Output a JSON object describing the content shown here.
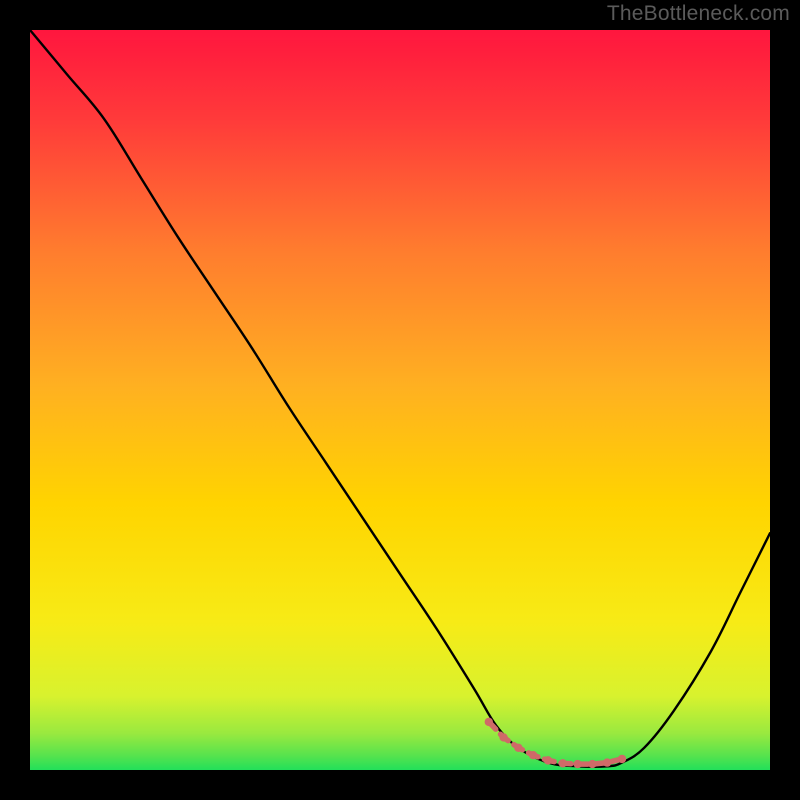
{
  "watermark": "TheBottleneck.com",
  "chart_data": {
    "type": "line",
    "title": "",
    "xlabel": "",
    "ylabel": "",
    "xlim": [
      0,
      100
    ],
    "ylim": [
      0,
      100
    ],
    "grid": false,
    "background_gradient": {
      "top_color": "#ff153e",
      "mid_color": "#ffd400",
      "bottom_color": "#20e35a"
    },
    "series": [
      {
        "name": "bottleneck-curve",
        "color": "#000000",
        "x": [
          0,
          5,
          10,
          15,
          20,
          25,
          30,
          35,
          40,
          45,
          50,
          55,
          60,
          63,
          66,
          70,
          74,
          78,
          80,
          83,
          87,
          92,
          96,
          100
        ],
        "values": [
          100,
          94,
          88,
          80,
          72,
          64.5,
          57,
          49,
          41.5,
          34,
          26.5,
          19,
          11,
          6,
          3,
          1,
          0.5,
          0.5,
          1,
          3,
          8,
          16,
          24,
          32
        ]
      },
      {
        "name": "bottleneck-sweet-spot",
        "color": "#cf6a68",
        "marker": true,
        "x": [
          62,
          64,
          66,
          68,
          70,
          72,
          74,
          76,
          78,
          80
        ],
        "values": [
          6.5,
          4.4,
          3.0,
          2.0,
          1.3,
          0.9,
          0.8,
          0.8,
          1.0,
          1.5
        ]
      }
    ]
  }
}
